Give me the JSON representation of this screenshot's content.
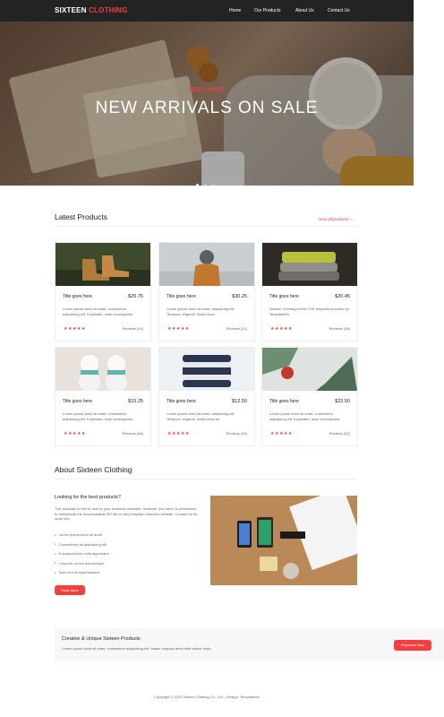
{
  "header": {
    "logo_main": "SIXTEEN",
    "logo_accent": "CLOTHING",
    "nav": [
      "Home",
      "Our Products",
      "About Us",
      "Contact Us"
    ]
  },
  "hero": {
    "offer": "BEST OFFER",
    "title": "NEW ARRIVALS ON SALE",
    "slides": 3,
    "active_slide": 1
  },
  "latest": {
    "title": "Latest Products",
    "view_all": "view all products →"
  },
  "products": [
    {
      "name": "Title goes here",
      "price": "$25.75",
      "desc": "Lorem ipsum dolor sit amet, consectetur adipisicing elit. Explicabo, esse consequatur.",
      "stars": "★★★★★",
      "reviews": "Reviews (24)"
    },
    {
      "name": "Title goes here",
      "price": "$30.25",
      "desc": "Lorem ipsum dolor sit amet, adipisicing elit. Tempora, eligendi. Nobis dolor.",
      "stars": "★★★★★",
      "reviews": "Reviews (21)"
    },
    {
      "name": "Title goes here",
      "price": "$20.45",
      "desc": "Sixteen Clothing is free CSS template provided by TemplateMo.",
      "stars": "★★★★★",
      "reviews": "Reviews (36)"
    },
    {
      "name": "Title goes here",
      "price": "$15.25",
      "desc": "Lorem ipsum dolor sit amet, consectetur adipisicing elit. Explicabo, esse consequatur.",
      "stars": "★★★★★",
      "reviews": "Reviews (48)"
    },
    {
      "name": "Title goes here",
      "price": "$12.50",
      "desc": "Lorem ipsum dolor sit amet, adipisicing elit. Tempora, eligendi. Nobis dolor sit.",
      "stars": "★★★★★",
      "reviews": "Reviews (16)"
    },
    {
      "name": "Title goes here",
      "price": "$22.50",
      "desc": "Lorem ipsum dolor sit amet, consectetur adipisicing elit. Explicabo, esse consequatur.",
      "stars": "★★★★★",
      "reviews": "Reviews (32)"
    }
  ],
  "about": {
    "title_main": "About Sixteen",
    "title_accent": "Clothing",
    "subtitle": "Looking for the best products?",
    "text": "This template is free to use for your business websites. However, you have no permission to redistribute the downloadable ZIP file on any template collection website. Contact us for more info.",
    "bullets": [
      "Lorem ipsum dolor sit amet",
      "Consectetur an adipisicing elit",
      "It aquecorporis nulla aspernatur",
      "Corporis, omnis doloremque",
      "Non cum id reprehenderit"
    ],
    "read_more": "Read More"
  },
  "cta": {
    "title": "Creative & Unique Sixteen Products",
    "text": "Lorem ipsum dolor sit amet, consectetur adipisicing elit. Itaque corporis amet elite author nulla.",
    "button": "Purchase Now"
  },
  "footer": {
    "text": "Copyright © 2020 Sixteen Clothing Co., Ltd.",
    "design": "- Design: TemplateMo"
  },
  "colors": {
    "accent": "#f33f3f",
    "header_bg": "#232323"
  }
}
